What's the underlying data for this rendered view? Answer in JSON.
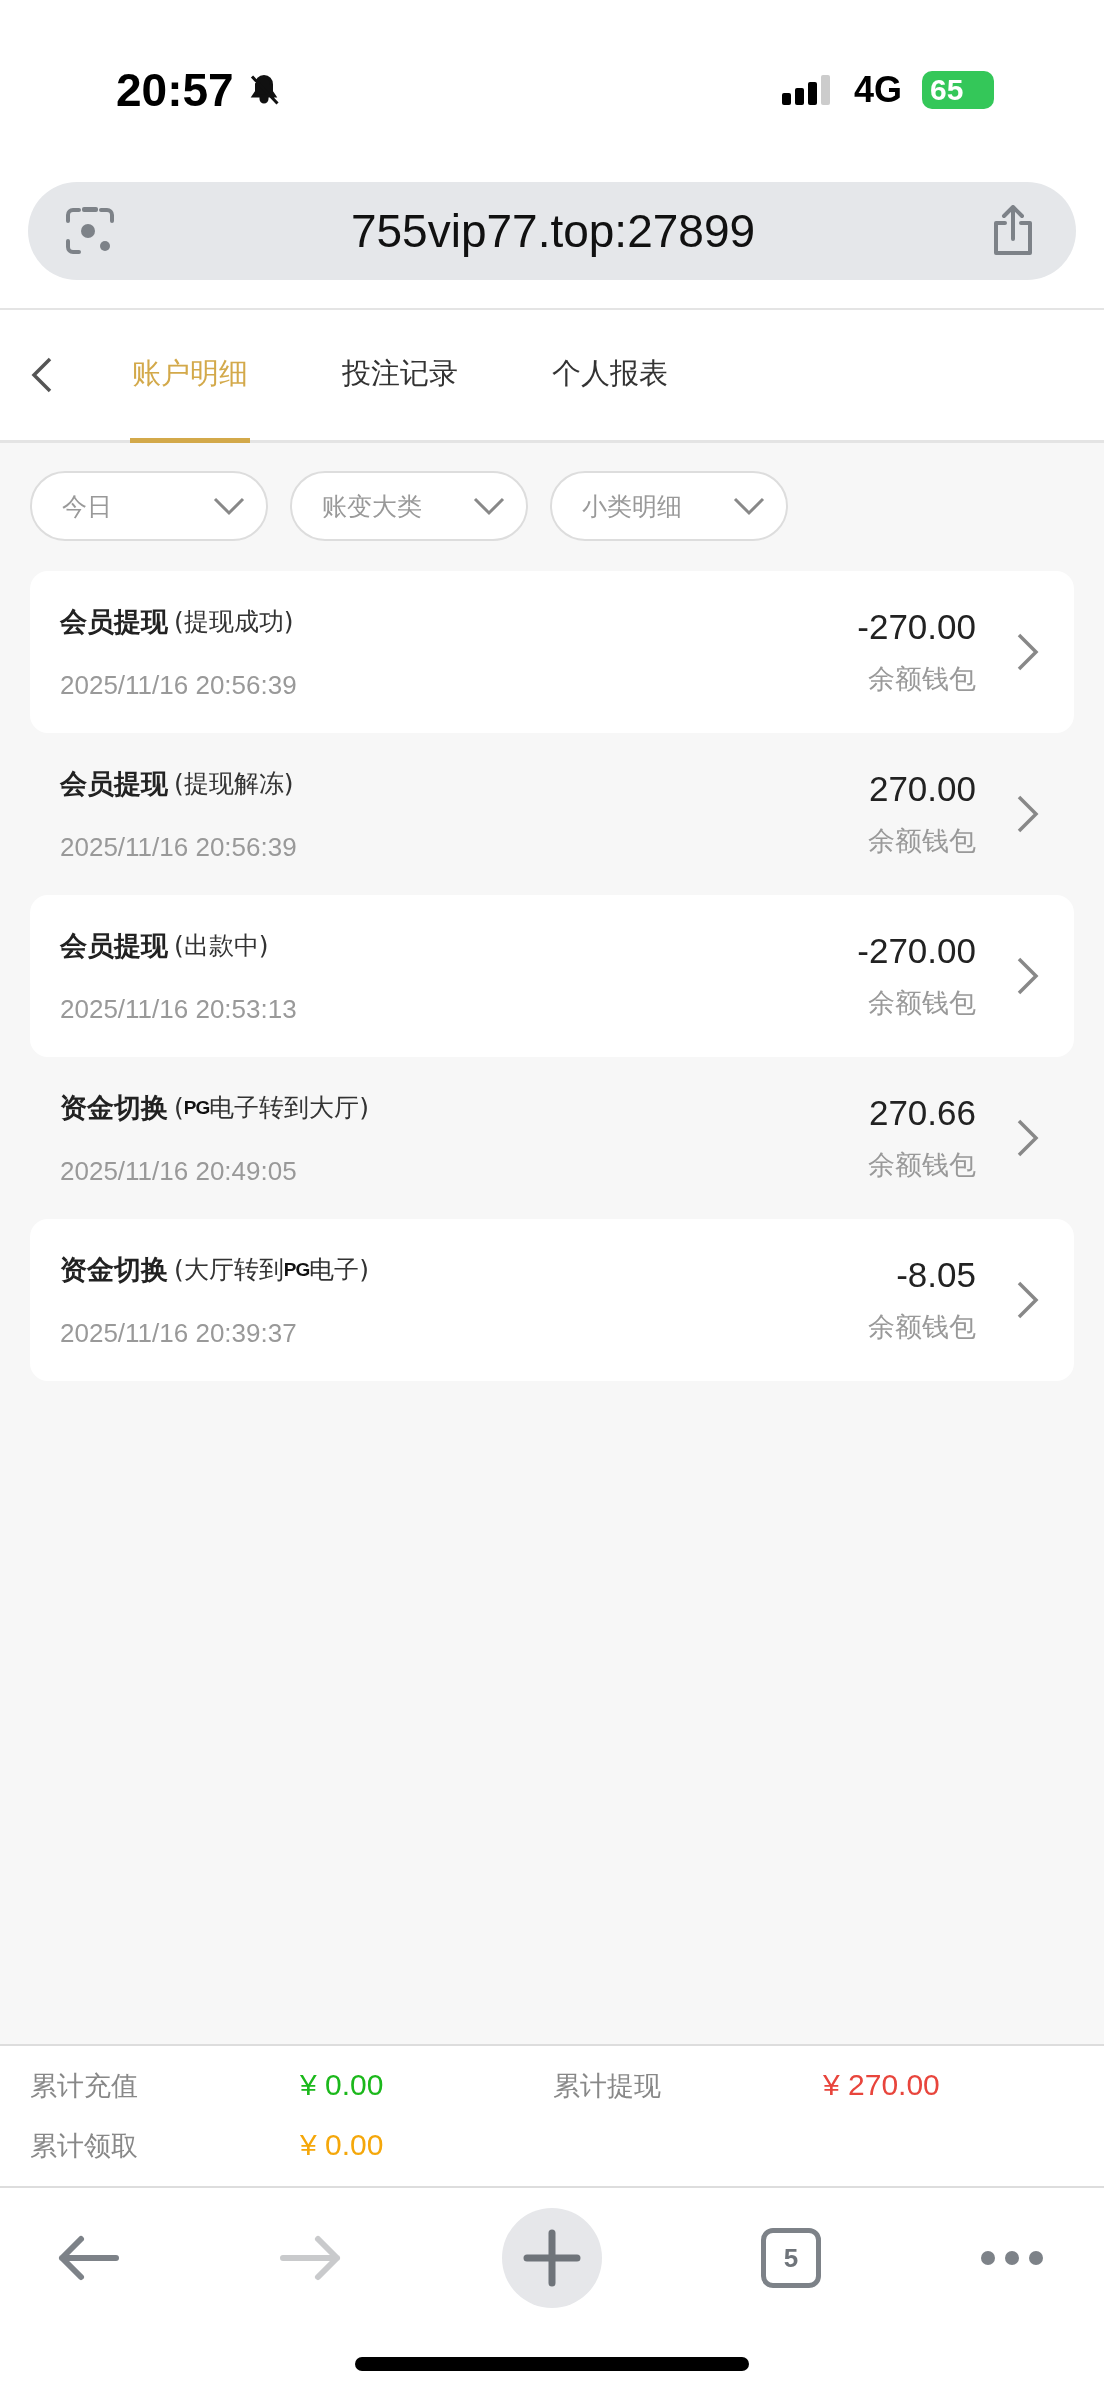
{
  "status_bar": {
    "time": "20:57",
    "network": "4G",
    "battery": "65"
  },
  "browser": {
    "url": "755vip77.top:27899",
    "tab_count": "5"
  },
  "tabs": [
    {
      "label": "账户明细",
      "selected": true
    },
    {
      "label": "投注记录",
      "selected": false
    },
    {
      "label": "个人报表",
      "selected": false
    }
  ],
  "filters": [
    {
      "label": "今日"
    },
    {
      "label": "账变大类"
    },
    {
      "label": "小类明细"
    }
  ],
  "records": [
    {
      "title": "会员提现",
      "detail": [
        {
          "kind": "text",
          "text": "(提现成功)"
        }
      ],
      "time": "2025/11/16 20:56:39",
      "amount": "-270.00",
      "wallet": "余额钱包"
    },
    {
      "title": "会员提现",
      "detail": [
        {
          "kind": "text",
          "text": "(提现解冻)"
        }
      ],
      "time": "2025/11/16 20:56:39",
      "amount": "270.00",
      "wallet": "余额钱包"
    },
    {
      "title": "会员提现",
      "detail": [
        {
          "kind": "text",
          "text": "(出款中)"
        }
      ],
      "time": "2025/11/16 20:53:13",
      "amount": "-270.00",
      "wallet": "余额钱包"
    },
    {
      "title": "资金切换",
      "detail": [
        {
          "kind": "text",
          "text": "("
        },
        {
          "kind": "logo",
          "text": "PG"
        },
        {
          "kind": "text",
          "text": "电子转到大厅)"
        }
      ],
      "time": "2025/11/16 20:49:05",
      "amount": "270.66",
      "wallet": "余额钱包"
    },
    {
      "title": "资金切换",
      "detail": [
        {
          "kind": "text",
          "text": "(大厅转到"
        },
        {
          "kind": "logo",
          "text": "PG"
        },
        {
          "kind": "text",
          "text": "电子)"
        }
      ],
      "time": "2025/11/16 20:39:37",
      "amount": "-8.05",
      "wallet": "余额钱包"
    }
  ],
  "summary": [
    {
      "label": "累计充值",
      "value": "¥ 0.00",
      "color": "#1bb81b"
    },
    {
      "label": "累计提现",
      "value": "¥ 270.00",
      "color": "#e8453c"
    },
    {
      "label": "累计领取",
      "value": "¥ 0.00",
      "color": "#f5a70a"
    }
  ]
}
